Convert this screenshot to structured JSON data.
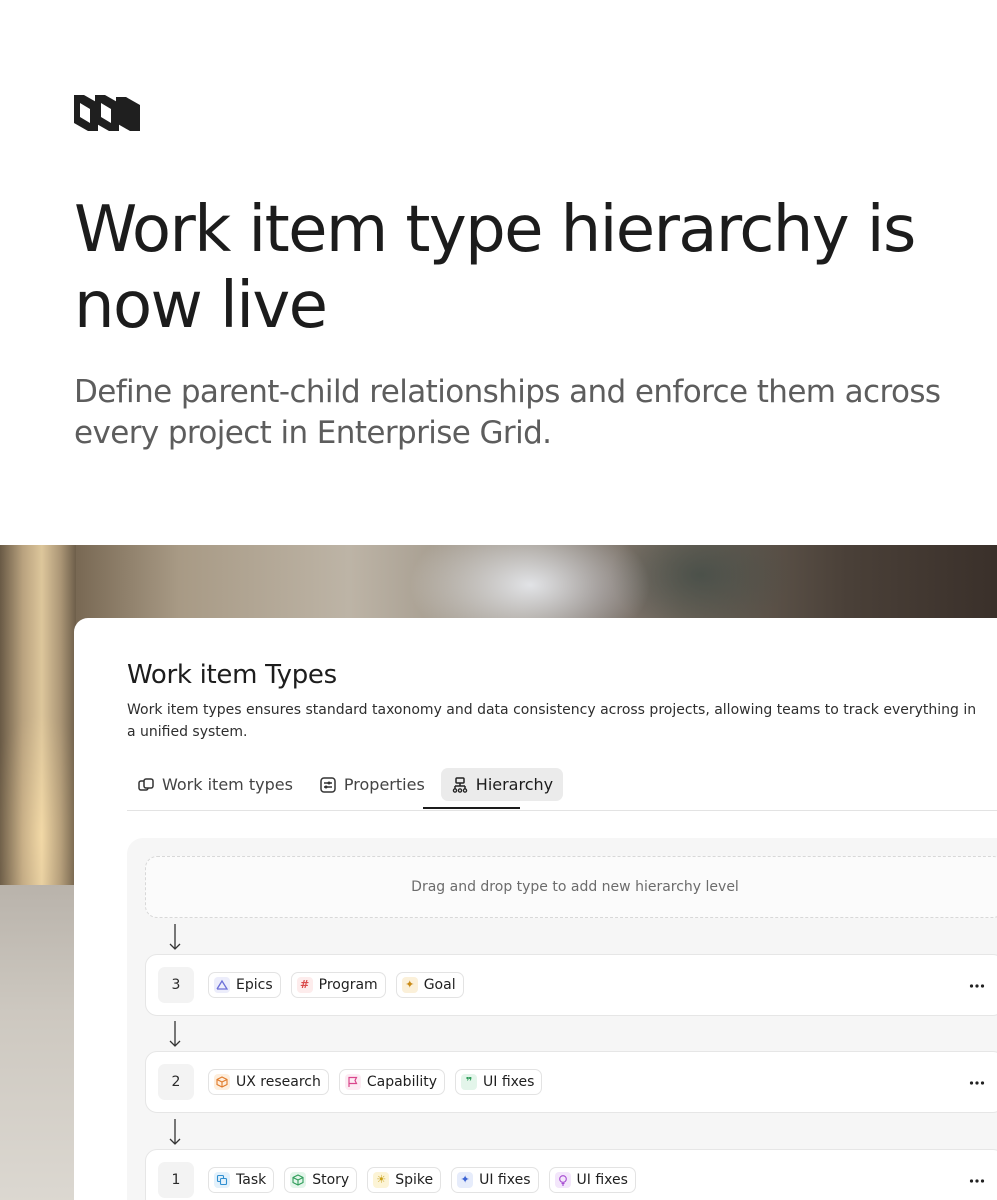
{
  "headline": "Work item type hierarchy is now live",
  "subhead": "Define parent-child relationships and enforce them across every project in Enterprise Grid.",
  "panel": {
    "title": "Work item Types",
    "description": "Work item types ensures standard taxonomy and data consistency across projects, allowing teams to track everything in a unified system."
  },
  "tabs": [
    {
      "label": "Work item types",
      "icon": "stack-icon"
    },
    {
      "label": "Properties",
      "icon": "sliders-icon"
    },
    {
      "label": "Hierarchy",
      "icon": "hierarchy-icon",
      "active": true
    }
  ],
  "dropzone_text": "Drag and drop type to add new hierarchy level",
  "levels": [
    {
      "number": "3",
      "types": [
        {
          "label": "Epics",
          "icon": "mountain-icon",
          "color": "#6b6fd8",
          "bg": "#ecedfb"
        },
        {
          "label": "Program",
          "icon": "hash-icon",
          "color": "#d94a4a",
          "bg": "#fdecec"
        },
        {
          "label": "Goal",
          "icon": "sparkle-icon",
          "color": "#c98a16",
          "bg": "#fbf0d9"
        }
      ]
    },
    {
      "number": "2",
      "types": [
        {
          "label": "UX research",
          "icon": "box-icon",
          "color": "#e07a2a",
          "bg": "#fdeedd"
        },
        {
          "label": "Capability",
          "icon": "flag-icon",
          "color": "#d9468c",
          "bg": "#fcebf3"
        },
        {
          "label": "UI fixes",
          "icon": "quote-icon",
          "color": "#2f9d5a",
          "bg": "#e3f5ea"
        }
      ]
    },
    {
      "number": "1",
      "types": [
        {
          "label": "Task",
          "icon": "layers-icon",
          "color": "#2f8fd1",
          "bg": "#e3f1fb"
        },
        {
          "label": "Story",
          "icon": "cube-icon",
          "color": "#2f9d5a",
          "bg": "#e3f5ea"
        },
        {
          "label": "Spike",
          "icon": "sun-icon",
          "color": "#c9a016",
          "bg": "#fcf4d6"
        },
        {
          "label": "UI fixes",
          "icon": "stars-icon",
          "color": "#3b63d4",
          "bg": "#e6ecfb"
        },
        {
          "label": "UI fixes",
          "icon": "bulb-icon",
          "color": "#a64bd1",
          "bg": "#f3e6fb"
        }
      ]
    }
  ]
}
